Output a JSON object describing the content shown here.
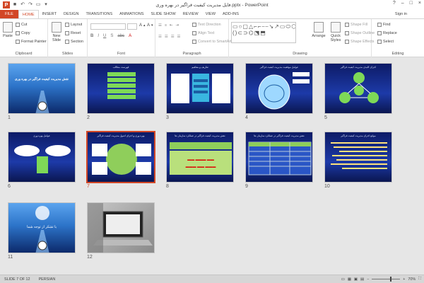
{
  "window": {
    "title": "فایل مدیریت کیفیت فراگیر در بهره وری.pptx - PowerPoint",
    "controls": [
      "?",
      "–",
      "□",
      "×"
    ]
  },
  "ribbon_tabs": [
    "FILE",
    "HOME",
    "INSERT",
    "DESIGN",
    "TRANSITIONS",
    "ANIMATIONS",
    "SLIDE SHOW",
    "REVIEW",
    "VIEW",
    "ADD-INS"
  ],
  "active_tab": "HOME",
  "signin": "Sign in",
  "clipboard": {
    "paste": "Paste",
    "cut": "Cut",
    "copy": "Copy",
    "format_painter": "Format Painter",
    "label": "Clipboard"
  },
  "slides_group": {
    "new_slide": "New Slide",
    "layout": "Layout",
    "reset": "Reset",
    "section": "Section",
    "label": "Slides"
  },
  "font_group": {
    "label": "Font"
  },
  "paragraph_group": {
    "text_direction": "Text Direction",
    "align_text": "Align Text",
    "convert_smartart": "Convert to SmartArt",
    "label": "Paragraph"
  },
  "drawing_group": {
    "arrange": "Arrange",
    "quick_styles": "Quick Styles",
    "shape_fill": "Shape Fill",
    "shape_outline": "Shape Outline",
    "shape_effects": "Shape Effects",
    "label": "Drawing"
  },
  "editing_group": {
    "find": "Find",
    "replace": "Replace",
    "select": "Select",
    "label": "Editing"
  },
  "slides": [
    {
      "num": "1",
      "title": "نقش مدیریت کیفیت فراگیر در بهره وری"
    },
    {
      "num": "2",
      "title": "فهرست مطالب"
    },
    {
      "num": "3",
      "title": "تعاریف و مفاهیم"
    },
    {
      "num": "4",
      "title": "عوامل موفقیت مدیریت کیفیت فراگیر"
    },
    {
      "num": "5",
      "title": "اجزای کلیدی مدیریت کیفیت فراگیر"
    },
    {
      "num": "6",
      "title": "عوامل بهره وری"
    },
    {
      "num": "7",
      "title": "بهره وری و اجرای اصول مدیریت کیفیت فراگیر"
    },
    {
      "num": "8",
      "title": "نقش مدیریت کیفیت فراگیر در عملکرد سازمان ها"
    },
    {
      "num": "9",
      "title": "نقش مدیریت کیفیت فراگیر در عملکرد سازمان ها"
    },
    {
      "num": "10",
      "title": "موانع اجرای مدیریت کیفیت فراگیر"
    },
    {
      "num": "11",
      "title": "با تشکر از توجه شما"
    },
    {
      "num": "12",
      "title": ""
    }
  ],
  "selected_slide": "7",
  "status": {
    "slide": "SLIDE 7 OF 12",
    "language": "PERSIAN",
    "zoom": "70%",
    "zoom_level": 0.7
  },
  "colors": {
    "accent": "#d24726",
    "slide_dark": "#0b1a6b",
    "slide_mid": "#1d3aa8"
  }
}
